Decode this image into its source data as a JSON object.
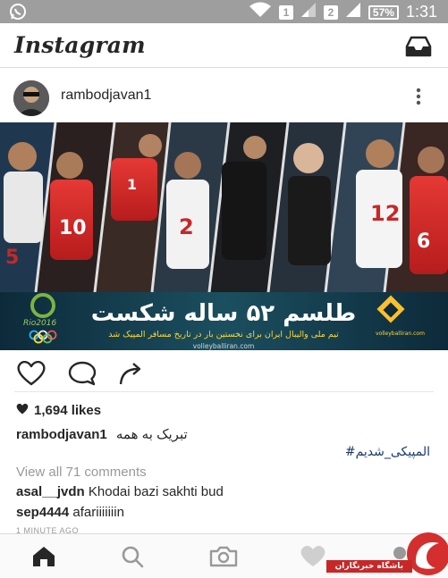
{
  "status_bar": {
    "sim1": "1",
    "sim2": "2",
    "battery": "57%",
    "time": "1:31"
  },
  "app": {
    "title": "Instagram"
  },
  "post": {
    "username": "rambodjavan1",
    "image_text": {
      "headline": "طلسم ۵۲ ساله شکست",
      "subline": "تیم ملی والیبال ایران برای نخستین بار در تاریخ مسافر المپیک شد",
      "site": "volleyballiran.com",
      "side_brand": "volleyballiran.com",
      "jersey_numbers": [
        "10",
        "1",
        "2",
        "12",
        "6",
        "5"
      ]
    },
    "likes": "1,694 likes",
    "caption_user": "rambodjavan1",
    "caption_text": "تبریک به همه",
    "hashtag": "#المپیکی_شدیم",
    "view_all_comments": "View all 71 comments",
    "comments": [
      {
        "user": "asal__jvdn",
        "text": "Khodai bazi sakhti bud"
      },
      {
        "user": "sep4444",
        "text": "afariiiiiiin"
      }
    ],
    "timestamp": "1 MINUTE AGO"
  },
  "watermark": {
    "text": "باشگاه خبرنگاران"
  },
  "colors": {
    "status_bar": "#9e9e9e",
    "text": "#262626",
    "muted": "#999999",
    "hashtag": "#1e3a6e",
    "watermark_red": "#c62828"
  }
}
